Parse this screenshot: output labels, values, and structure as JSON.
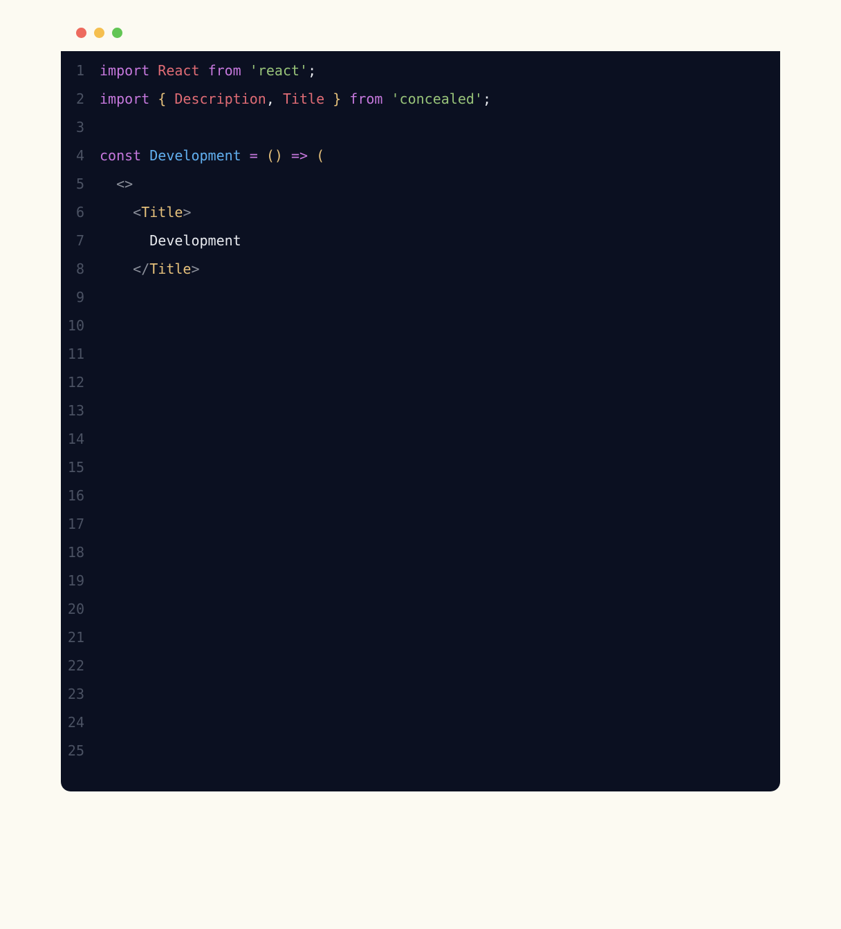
{
  "window": {
    "traffic_lights": [
      "close",
      "minimize",
      "maximize"
    ]
  },
  "editor": {
    "total_lines": 25,
    "lines": [
      {
        "n": "1",
        "tokens": [
          {
            "t": "import",
            "c": "tok-keyword"
          },
          {
            "t": " ",
            "c": ""
          },
          {
            "t": "React",
            "c": "tok-var"
          },
          {
            "t": " ",
            "c": ""
          },
          {
            "t": "from",
            "c": "tok-from"
          },
          {
            "t": " ",
            "c": ""
          },
          {
            "t": "'react'",
            "c": "tok-string"
          },
          {
            "t": ";",
            "c": "tok-punc"
          }
        ]
      },
      {
        "n": "2",
        "tokens": [
          {
            "t": "import",
            "c": "tok-keyword"
          },
          {
            "t": " ",
            "c": ""
          },
          {
            "t": "{",
            "c": "tok-brace"
          },
          {
            "t": " ",
            "c": ""
          },
          {
            "t": "Description",
            "c": "tok-ident"
          },
          {
            "t": ",",
            "c": "tok-punc"
          },
          {
            "t": " ",
            "c": ""
          },
          {
            "t": "Title",
            "c": "tok-ident"
          },
          {
            "t": " ",
            "c": ""
          },
          {
            "t": "}",
            "c": "tok-brace"
          },
          {
            "t": " ",
            "c": ""
          },
          {
            "t": "from",
            "c": "tok-from"
          },
          {
            "t": " ",
            "c": ""
          },
          {
            "t": "'concealed'",
            "c": "tok-string"
          },
          {
            "t": ";",
            "c": "tok-punc"
          }
        ]
      },
      {
        "n": "3",
        "tokens": []
      },
      {
        "n": "4",
        "tokens": [
          {
            "t": "const",
            "c": "tok-keyword"
          },
          {
            "t": " ",
            "c": ""
          },
          {
            "t": "Development",
            "c": "tok-func"
          },
          {
            "t": " ",
            "c": ""
          },
          {
            "t": "=",
            "c": "tok-op"
          },
          {
            "t": " ",
            "c": ""
          },
          {
            "t": "(",
            "c": "tok-paren"
          },
          {
            "t": ")",
            "c": "tok-paren"
          },
          {
            "t": " ",
            "c": ""
          },
          {
            "t": "=>",
            "c": "tok-op"
          },
          {
            "t": " ",
            "c": ""
          },
          {
            "t": "(",
            "c": "tok-paren"
          }
        ]
      },
      {
        "n": "5",
        "tokens": [
          {
            "t": "  ",
            "c": ""
          },
          {
            "t": "<>",
            "c": "tok-angle"
          }
        ]
      },
      {
        "n": "6",
        "tokens": [
          {
            "t": "    ",
            "c": ""
          },
          {
            "t": "<",
            "c": "tok-angle"
          },
          {
            "t": "Title",
            "c": "tok-tag"
          },
          {
            "t": ">",
            "c": "tok-angle"
          }
        ]
      },
      {
        "n": "7",
        "tokens": [
          {
            "t": "      ",
            "c": ""
          },
          {
            "t": "Development",
            "c": "tok-text"
          }
        ]
      },
      {
        "n": "8",
        "tokens": [
          {
            "t": "    ",
            "c": ""
          },
          {
            "t": "</",
            "c": "tok-angle"
          },
          {
            "t": "Title",
            "c": "tok-tag"
          },
          {
            "t": ">",
            "c": "tok-angle"
          }
        ]
      },
      {
        "n": "9",
        "tokens": []
      },
      {
        "n": "10",
        "tokens": []
      },
      {
        "n": "11",
        "tokens": []
      },
      {
        "n": "12",
        "tokens": []
      },
      {
        "n": "13",
        "tokens": []
      },
      {
        "n": "14",
        "tokens": []
      },
      {
        "n": "15",
        "tokens": []
      },
      {
        "n": "16",
        "tokens": []
      },
      {
        "n": "17",
        "tokens": []
      },
      {
        "n": "18",
        "tokens": []
      },
      {
        "n": "19",
        "tokens": []
      },
      {
        "n": "20",
        "tokens": []
      },
      {
        "n": "21",
        "tokens": []
      },
      {
        "n": "22",
        "tokens": []
      },
      {
        "n": "23",
        "tokens": []
      },
      {
        "n": "24",
        "tokens": []
      },
      {
        "n": "25",
        "tokens": []
      }
    ]
  }
}
